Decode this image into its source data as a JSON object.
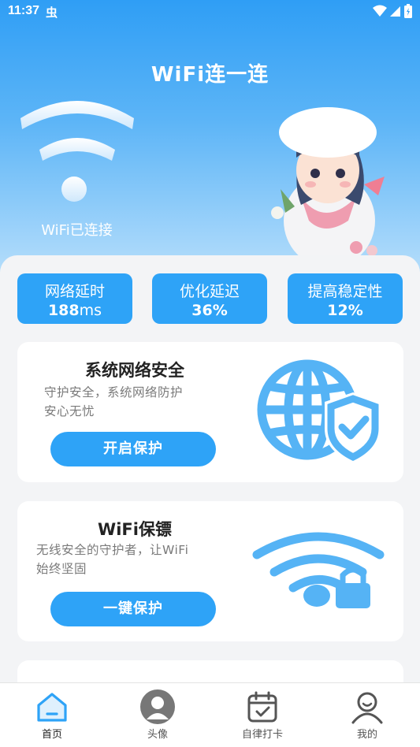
{
  "status_bar": {
    "time": "11:37",
    "left_icon_glyph": "虫"
  },
  "header": {
    "title": "WiFi连一连",
    "wifi_status": "WiFi已连接"
  },
  "stats": [
    {
      "label": "网络延时",
      "value": "188",
      "unit": "ms"
    },
    {
      "label": "优化延迟",
      "value": "36%",
      "unit": ""
    },
    {
      "label": "提高稳定性",
      "value": "12%",
      "unit": ""
    }
  ],
  "cards": [
    {
      "title": "系统网络安全",
      "desc_line1": "守护安全，系统网络防护",
      "desc_line2": "安心无忧",
      "button": "开启保护",
      "icon": "globe-shield-icon"
    },
    {
      "title": "WiFi保镖",
      "desc_line1": "无线安全的守护者，让WiFi",
      "desc_line2": "始终坚固",
      "button": "一键保护",
      "icon": "wifi-lock-icon"
    }
  ],
  "tabs": [
    {
      "label": "首页",
      "icon": "home-icon",
      "active": true
    },
    {
      "label": "头像",
      "icon": "avatar-icon",
      "active": false
    },
    {
      "label": "自律打卡",
      "icon": "calendar-check-icon",
      "active": false
    },
    {
      "label": "我的",
      "icon": "user-icon",
      "active": false
    }
  ],
  "colors": {
    "accent": "#2ea3f7",
    "hero_top": "#2f9ef5",
    "illustration": "#55b3f5"
  }
}
